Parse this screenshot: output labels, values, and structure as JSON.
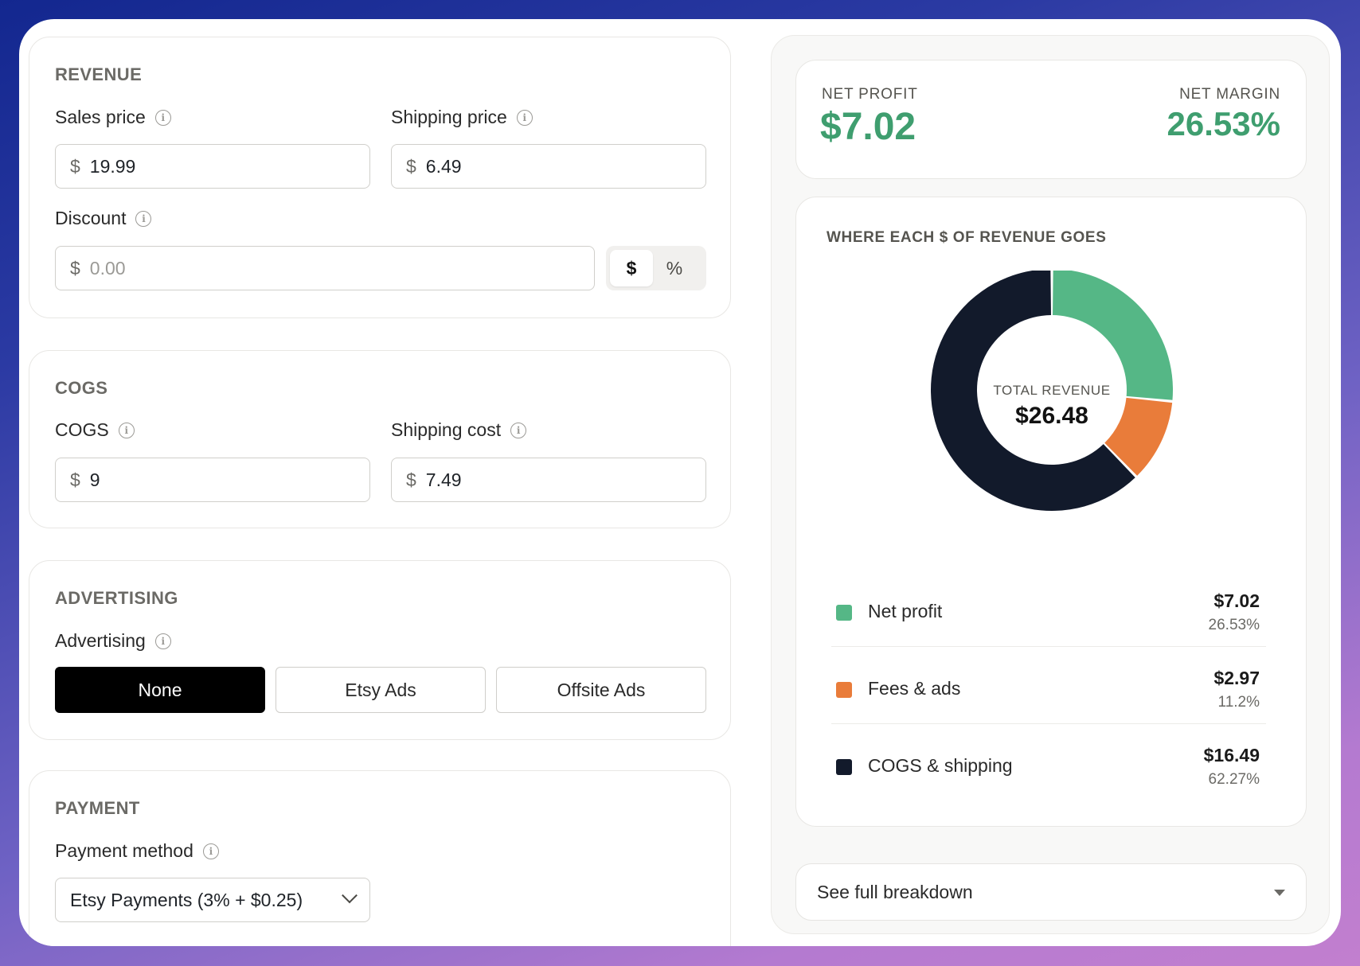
{
  "revenue": {
    "title": "REVENUE",
    "sales_price": {
      "label": "Sales price",
      "currency": "$",
      "value": "19.99"
    },
    "shipping_price": {
      "label": "Shipping price",
      "currency": "$",
      "value": "6.49"
    },
    "discount": {
      "label": "Discount",
      "currency": "$",
      "placeholder": "0.00",
      "mode_options": [
        "$",
        "%"
      ],
      "mode_selected": "$"
    }
  },
  "cogs": {
    "title": "COGS",
    "cogs": {
      "label": "COGS",
      "currency": "$",
      "value": "9"
    },
    "shipping_cost": {
      "label": "Shipping cost",
      "currency": "$",
      "value": "7.49"
    }
  },
  "advertising": {
    "title": "ADVERTISING",
    "label": "Advertising",
    "options": [
      "None",
      "Etsy Ads",
      "Offsite Ads"
    ],
    "selected": "None"
  },
  "payment": {
    "title": "PAYMENT",
    "label": "Payment method",
    "selected": "Etsy Payments (3% + $0.25)"
  },
  "summary": {
    "net_profit_label": "NET PROFIT",
    "net_profit_value": "$7.02",
    "net_margin_label": "NET MARGIN",
    "net_margin_value": "26.53%"
  },
  "breakdown_toggle": "See full breakdown",
  "chart_data": {
    "type": "pie",
    "title": "WHERE EACH $ OF REVENUE GOES",
    "center_label": "TOTAL REVENUE",
    "center_value": "$26.48",
    "slices": [
      {
        "name": "Net profit",
        "value": 7.02,
        "value_label": "$7.02",
        "percent_label": "26.53%",
        "color": "#55b786"
      },
      {
        "name": "Fees & ads",
        "value": 2.97,
        "value_label": "$2.97",
        "percent_label": "11.2%",
        "color": "#e97c3a"
      },
      {
        "name": "COGS & shipping",
        "value": 16.49,
        "value_label": "$16.49",
        "percent_label": "62.27%",
        "color": "#121a2b"
      }
    ]
  },
  "colors": {
    "accent_green": "#3f9e6f",
    "selected_button": "#000000"
  }
}
